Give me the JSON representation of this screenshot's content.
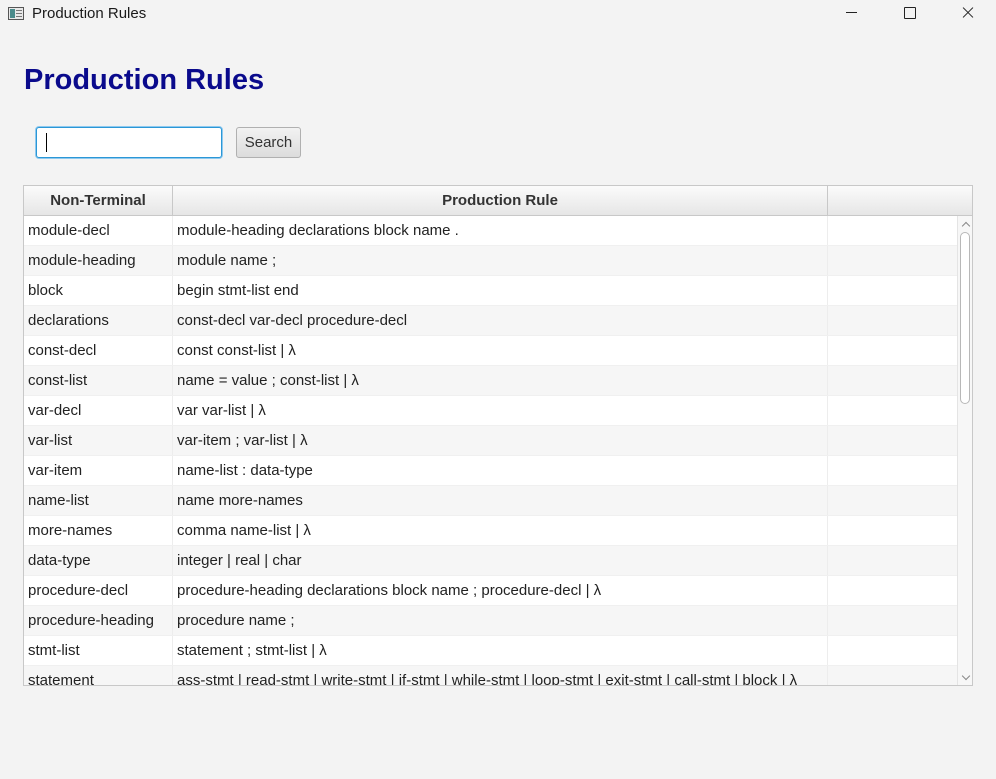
{
  "window": {
    "title": "Production Rules"
  },
  "page": {
    "heading": "Production Rules",
    "heading_color": "#0a0a8c"
  },
  "search": {
    "value": "",
    "placeholder": "",
    "button_label": "Search"
  },
  "table": {
    "columns": [
      "Non-Terminal",
      "Production Rule",
      ""
    ],
    "rows": [
      {
        "nonterminal": "module-decl",
        "rule": "module-heading declarations block name ."
      },
      {
        "nonterminal": "module-heading",
        "rule": "module name ;"
      },
      {
        "nonterminal": "block",
        "rule": "begin stmt-list end"
      },
      {
        "nonterminal": "declarations",
        "rule": "const-decl var-decl procedure-decl"
      },
      {
        "nonterminal": "const-decl",
        "rule": "const const-list | λ"
      },
      {
        "nonterminal": "const-list",
        "rule": "name = value ; const-list | λ"
      },
      {
        "nonterminal": "var-decl",
        "rule": "var var-list | λ"
      },
      {
        "nonterminal": "var-list",
        "rule": "var-item ; var-list | λ"
      },
      {
        "nonterminal": "var-item",
        "rule": "name-list : data-type"
      },
      {
        "nonterminal": "name-list",
        "rule": "name more-names"
      },
      {
        "nonterminal": "more-names",
        "rule": "comma name-list | λ"
      },
      {
        "nonterminal": "data-type",
        "rule": "integer | real | char"
      },
      {
        "nonterminal": "procedure-decl",
        "rule": "procedure-heading declarations block name ; procedure-decl | λ"
      },
      {
        "nonterminal": "procedure-heading",
        "rule": "procedure name ;"
      },
      {
        "nonterminal": "stmt-list",
        "rule": "statement ; stmt-list | λ"
      },
      {
        "nonterminal": "statement",
        "rule": "ass-stmt | read-stmt | write-stmt | if-stmt | while-stmt | loop-stmt | exit-stmt | call-stmt | block | λ"
      }
    ],
    "scroll_position": 0
  }
}
